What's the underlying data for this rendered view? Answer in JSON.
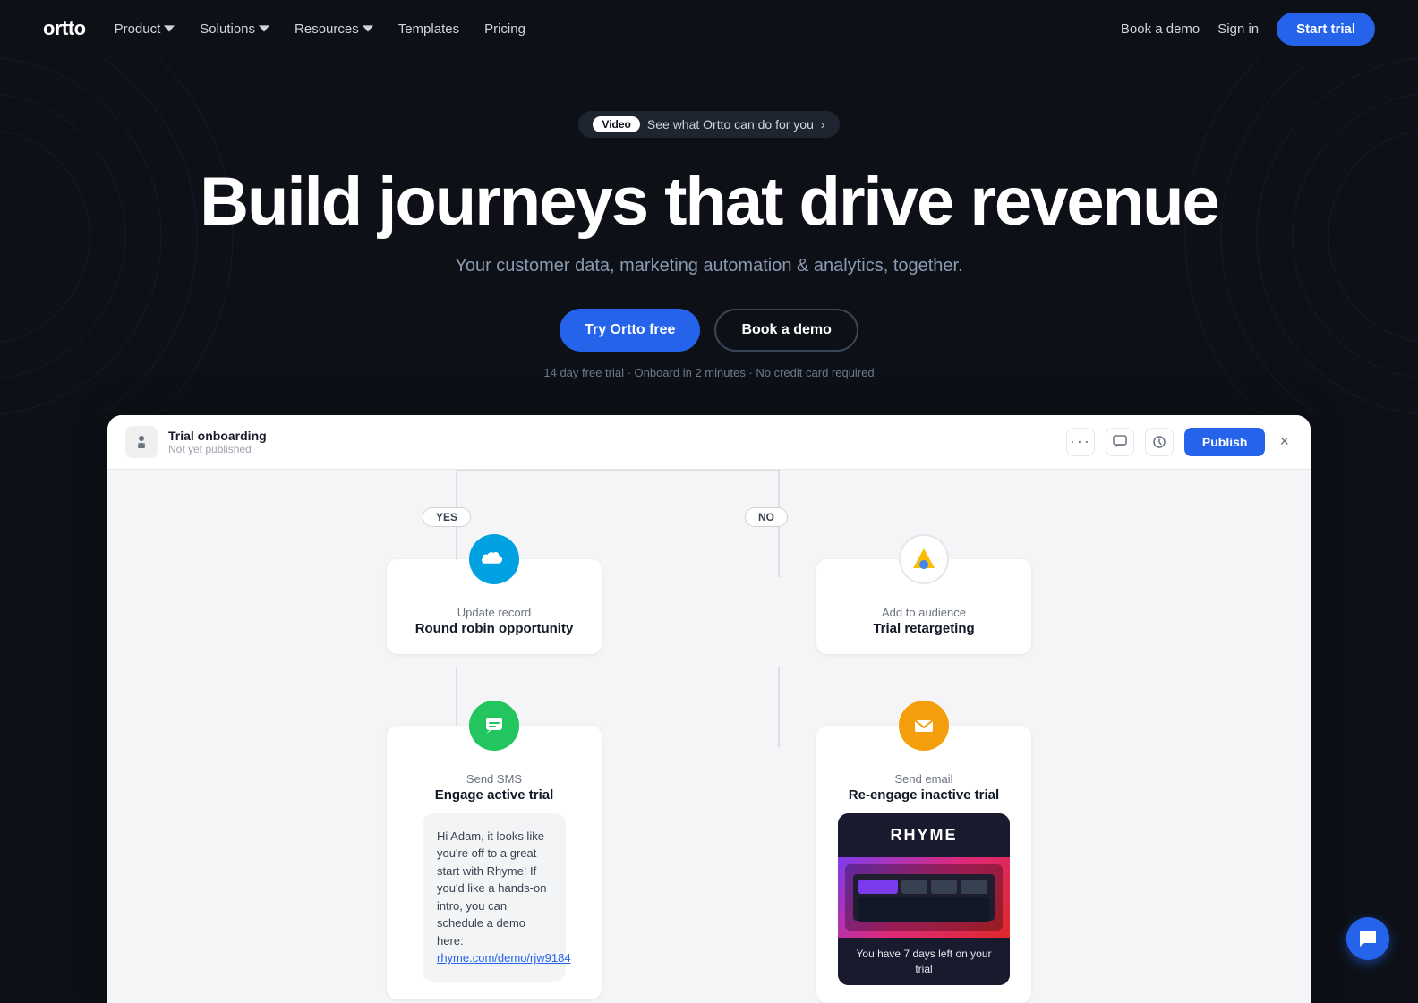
{
  "nav": {
    "logo": "ortto",
    "links": [
      {
        "id": "product",
        "label": "Product",
        "has_dropdown": true
      },
      {
        "id": "solutions",
        "label": "Solutions",
        "has_dropdown": true
      },
      {
        "id": "resources",
        "label": "Resources",
        "has_dropdown": true
      },
      {
        "id": "templates",
        "label": "Templates",
        "has_dropdown": false
      },
      {
        "id": "pricing",
        "label": "Pricing",
        "has_dropdown": false
      }
    ],
    "book_demo": "Book a demo",
    "sign_in": "Sign in",
    "start_trial": "Start trial"
  },
  "hero": {
    "badge_label": "Video",
    "badge_text": "See what Ortto can do for you",
    "title": "Build journeys that drive revenue",
    "subtitle": "Your customer data, marketing automation & analytics, together.",
    "cta_primary": "Try Ortto free",
    "cta_secondary": "Book a demo",
    "footnote": "14 day free trial · Onboard in 2 minutes · No credit card required"
  },
  "panel": {
    "title": "Trial onboarding",
    "status": "Not yet published",
    "publish_label": "Publish",
    "close_label": "×",
    "branch_yes": "YES",
    "branch_no": "NO",
    "nodes": [
      {
        "id": "update-record",
        "action_label": "Update record",
        "name": "Round robin opportunity",
        "icon_type": "salesforce",
        "branch": "yes"
      },
      {
        "id": "add-audience",
        "action_label": "Add to audience",
        "name": "Trial retargeting",
        "icon_type": "google-ads",
        "branch": "no"
      },
      {
        "id": "send-sms",
        "action_label": "Send SMS",
        "name": "Engage active trial",
        "icon_type": "sms",
        "branch": "yes",
        "preview": {
          "text": "Hi Adam, it looks like you're off to a great start with Rhyme! If you'd like a hands-on intro, you can schedule a demo here:",
          "link": "rhyme.com/demo/rjw9184"
        }
      },
      {
        "id": "send-email",
        "action_label": "Send email",
        "name": "Re-engage inactive trial",
        "icon_type": "email",
        "branch": "no",
        "preview": {
          "brand": "RHYME",
          "content": "You have 7 days left on your trial"
        }
      }
    ]
  },
  "chat": {
    "icon": "chat-icon"
  },
  "colors": {
    "primary_blue": "#2563eb",
    "salesforce_blue": "#00a1e0",
    "sms_green": "#22c55e",
    "email_yellow": "#f59e0b"
  }
}
